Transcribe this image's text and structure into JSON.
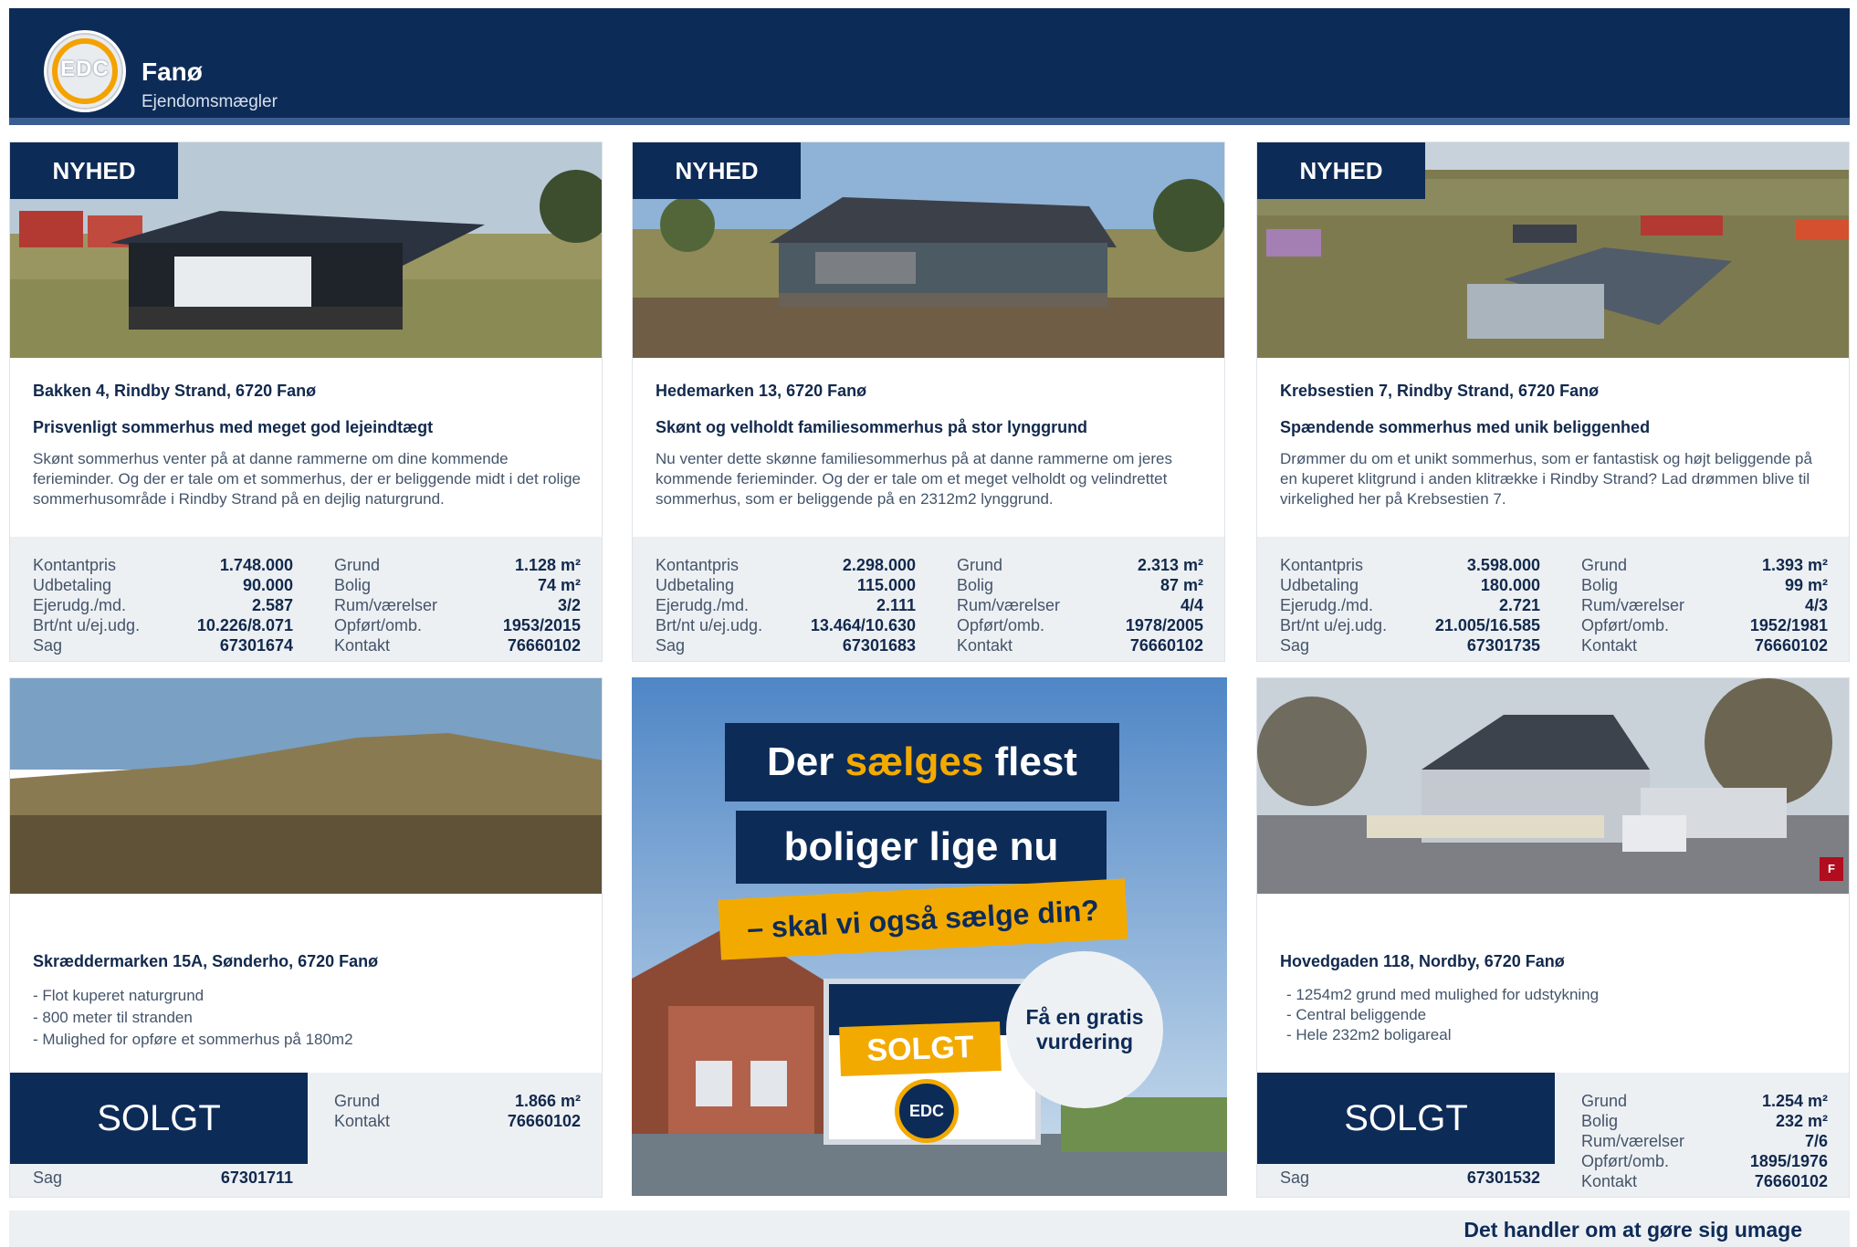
{
  "header": {
    "title": "Fanø",
    "subtitle": "Ejendomsmægler",
    "logo_text": "EDC"
  },
  "labels": {
    "new": "NYHED",
    "sold": "SOLGT"
  },
  "listings": [
    {
      "address": "Bakken 4, Rindby Strand, 6720 Fanø",
      "headline": "Prisvenligt sommerhus med meget god lejeindtægt",
      "description": "Skønt sommerhus venter på at danne rammerne om dine kommende ferieminder. Og der er tale om et sommerhus, der er beliggende midt i det rolige sommerhusområde i Rindby Strand på en dejlig naturgrund.",
      "left_stats": [
        {
          "label": "Kontantpris",
          "value": "1.748.000"
        },
        {
          "label": "Udbetaling",
          "value": "90.000"
        },
        {
          "label": "Ejerudg./md.",
          "value": "2.587"
        },
        {
          "label": "Brt/nt u/ej.udg.",
          "value": "10.226/8.071"
        },
        {
          "label": "Sag",
          "value": "67301674"
        }
      ],
      "right_stats": [
        {
          "label": "Grund",
          "value": "1.128 m²"
        },
        {
          "label": "Bolig",
          "value": "74 m²"
        },
        {
          "label": "Rum/værelser",
          "value": "3/2"
        },
        {
          "label": "Opført/omb.",
          "value": "1953/2015"
        },
        {
          "label": "Kontakt",
          "value": "76660102"
        }
      ]
    },
    {
      "address": "Hedemarken 13, 6720 Fanø",
      "headline": "Skønt og velholdt familiesommerhus på stor lynggrund",
      "description": "Nu venter dette skønne familiesommerhus på at danne rammerne om jeres kommende ferieminder. Og der er tale om et meget velholdt og velindrettet sommerhus, som er beliggende på en 2312m2 lynggrund.",
      "left_stats": [
        {
          "label": "Kontantpris",
          "value": "2.298.000"
        },
        {
          "label": "Udbetaling",
          "value": "115.000"
        },
        {
          "label": "Ejerudg./md.",
          "value": "2.111"
        },
        {
          "label": "Brt/nt u/ej.udg.",
          "value": "13.464/10.630"
        },
        {
          "label": "Sag",
          "value": "67301683"
        }
      ],
      "right_stats": [
        {
          "label": "Grund",
          "value": "2.313 m²"
        },
        {
          "label": "Bolig",
          "value": "87 m²"
        },
        {
          "label": "Rum/værelser",
          "value": "4/4"
        },
        {
          "label": "Opført/omb.",
          "value": "1978/2005"
        },
        {
          "label": "Kontakt",
          "value": "76660102"
        }
      ]
    },
    {
      "address": "Krebsestien 7, Rindby Strand, 6720 Fanø",
      "headline": "Spændende sommerhus med unik beliggenhed",
      "description": "Drømmer du om et unikt sommerhus, som er fantastisk og højt beliggende på en kuperet klitgrund i anden klitrække i Rindby Strand? Lad drømmen blive til virkelighed her på Krebsestien 7.",
      "left_stats": [
        {
          "label": "Kontantpris",
          "value": "3.598.000"
        },
        {
          "label": "Udbetaling",
          "value": "180.000"
        },
        {
          "label": "Ejerudg./md.",
          "value": "2.721"
        },
        {
          "label": "Brt/nt u/ej.udg.",
          "value": "21.005/16.585"
        },
        {
          "label": "Sag",
          "value": "67301735"
        }
      ],
      "right_stats": [
        {
          "label": "Grund",
          "value": "1.393 m²"
        },
        {
          "label": "Bolig",
          "value": "99 m²"
        },
        {
          "label": "Rum/værelser",
          "value": "4/3"
        },
        {
          "label": "Opført/omb.",
          "value": "1952/1981"
        },
        {
          "label": "Kontakt",
          "value": "76660102"
        }
      ]
    },
    {
      "address": "Skræddermarken 15A, Sønderho, 6720 Fanø",
      "bullets": [
        "- Flot kuperet naturgrund",
        "- 800 meter til stranden",
        "- Mulighed for opføre et sommerhus på 180m2"
      ],
      "sag": {
        "label": "Sag",
        "value": "67301711"
      },
      "right_stats": [
        {
          "label": "Grund",
          "value": "1.866 m²"
        },
        {
          "label": "Kontakt",
          "value": "76660102"
        }
      ]
    },
    {
      "address": "Hovedgaden 118, Nordby, 6720 Fanø",
      "badge": "F",
      "bullets": [
        "- 1254m2 grund med mulighed for udstykning",
        "- Central beliggende",
        "- Hele 232m2 boligareal"
      ],
      "sag": {
        "label": "Sag",
        "value": "67301532"
      },
      "right_stats": [
        {
          "label": "Grund",
          "value": "1.254 m²"
        },
        {
          "label": "Bolig",
          "value": "232 m²"
        },
        {
          "label": "Rum/værelser",
          "value": "7/6"
        },
        {
          "label": "Opført/omb.",
          "value": "1895/1976"
        },
        {
          "label": "Kontakt",
          "value": "76660102"
        }
      ]
    }
  ],
  "ad": {
    "line1_pre": "Der ",
    "line1_hl": "sælges",
    "line1_post": " flest",
    "line2": "boliger lige nu",
    "line3": "– skal vi også sælge din?",
    "sign_text": "SOLGT",
    "cta": "Få en gratis vurdering",
    "logo_text": "EDC"
  },
  "footer": {
    "text": "Det handler om at gøre sig umage"
  },
  "colors": {
    "navy": "#0d2b57",
    "accent": "#f3aa00",
    "panel": "#edf0f3"
  }
}
